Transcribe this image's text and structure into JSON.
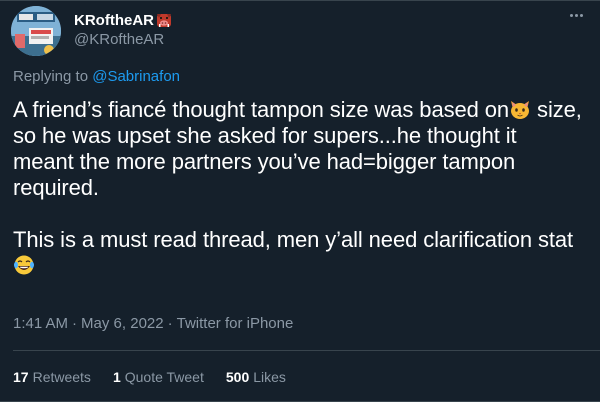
{
  "author": {
    "display_name": "KRoftheAR",
    "handle": "@KRoftheAR",
    "name_emoji": "boar-face-emoji"
  },
  "reply_to": {
    "prefix": "Replying to",
    "handle": "@Sabrinafon"
  },
  "tweet": {
    "line1_text": "A friend’s fiancé thought tampon size was based on",
    "line1_emoji": "cat-face-emoji",
    "paragraph1_rest": "size, so he was upset she asked for supers...he thought it meant the more partners you’ve had=bigger tampon required.",
    "paragraph2_text": "This is a must read thread, men y’all need clarification stat",
    "paragraph2_emoji": "face-with-tears-of-joy-emoji"
  },
  "meta": {
    "time": "1:41 AM",
    "date": "May 6, 2022",
    "source": "Twitter for iPhone",
    "separator": "·"
  },
  "stats": {
    "retweets_count": "17",
    "retweets_label": "Retweets",
    "quotes_count": "1",
    "quotes_label": "Quote Tweet",
    "likes_count": "500",
    "likes_label": "Likes"
  },
  "colors": {
    "background": "#15202b",
    "text": "#ffffff",
    "secondary": "#8b98a5",
    "link": "#1d9bf0",
    "divider": "#38444d"
  }
}
